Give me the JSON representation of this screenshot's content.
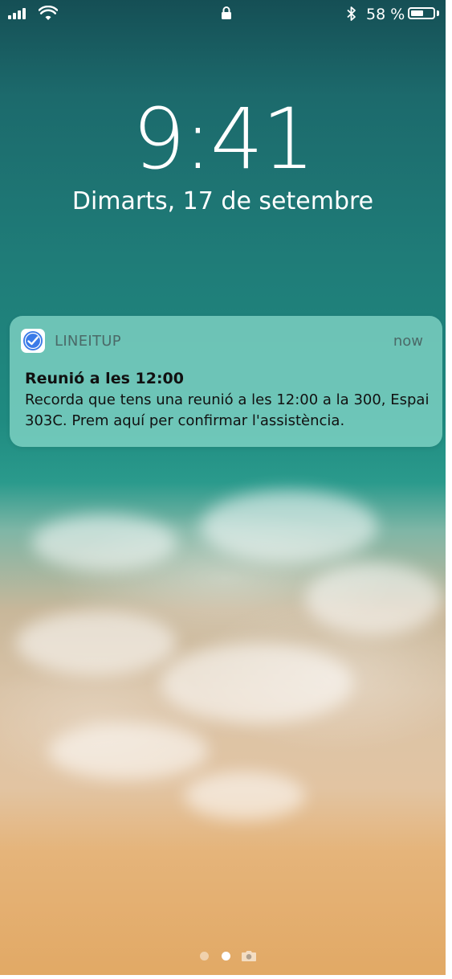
{
  "status_bar": {
    "battery_percent_label": "58 %",
    "battery_level": 0.58,
    "icons": [
      "signal-icon",
      "wifi-icon",
      "lock-icon",
      "bluetooth-icon",
      "battery-icon"
    ]
  },
  "lock_screen": {
    "time": "9:41",
    "date": "Dimarts, 17 de setembre"
  },
  "notification": {
    "app_name": "LINEITUP",
    "timestamp": "now",
    "title": "Reunió a les 12:00",
    "body": "Recorda que tens una reunió a les 12:00 a la 300, Espai 303C. Prem aquí per confirmar l'assistència.",
    "app_icon": "lineitup-app-icon",
    "accent_color": "#3b7be8"
  },
  "page_indicator": {
    "pages": 2,
    "current_page": 2,
    "extra_icon": "camera-icon"
  }
}
